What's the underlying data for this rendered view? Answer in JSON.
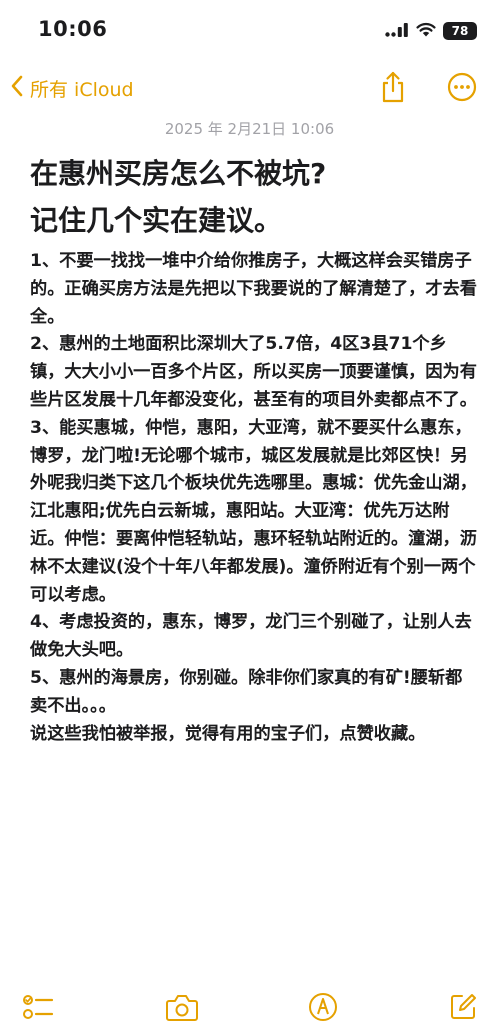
{
  "status": {
    "time": "10:06",
    "battery": "78"
  },
  "nav": {
    "back_label": "所有 iCloud"
  },
  "note": {
    "date": "2025 年 2月21日 10:06",
    "title_lines": [
      "在惠州买房怎么不被坑?",
      "记住几个实在建议。"
    ],
    "paragraphs": [
      "1、不要一找找一堆中介给你推房子，大概这样会买错房子的。正确买房方法是先把以下我要说的了解清楚了，才去看全。",
      "2、惠州的土地面积比深圳大了5.7倍，4区3县71个乡镇，大大小小一百多个片区，所以买房一顶要谨慎，因为有些片区发展十几年都没变化，甚至有的项目外卖都点不了。",
      "3、能买惠城，仲恺，惠阳，大亚湾，就不要买什么惠东，博罗，龙门啦!无论哪个城市，城区发展就是比郊区快！另外呢我归类下这几个板块优先选哪里。惠城：优先金山湖，江北惠阳;优先白云新城，惠阳站。大亚湾：优先万达附近。仲恺：要离仲恺轻轨站，惠环轻轨站附近的。潼湖，沥林不太建议(没个十年八年都发展)。潼侨附近有个别一两个可以考虑。",
      "4、考虑投资的，惠东，博罗，龙门三个别碰了，让别人去做免大头吧。",
      "5、惠州的海景房，你别碰。除非你们家真的有矿!腰斩都卖不出。。。",
      "说这些我怕被举报，觉得有用的宝子们，点赞收藏。"
    ]
  },
  "icons": {
    "back": "chevron-left-icon",
    "share": "share-icon",
    "more": "ellipsis-circle-icon",
    "checklist": "checklist-icon",
    "camera": "camera-icon",
    "markup": "markup-pen-icon",
    "compose": "compose-icon"
  },
  "colors": {
    "accent": "#e5a100",
    "text": "#1c1c1e",
    "date": "#a2a2a7",
    "background": "#ffffff"
  }
}
